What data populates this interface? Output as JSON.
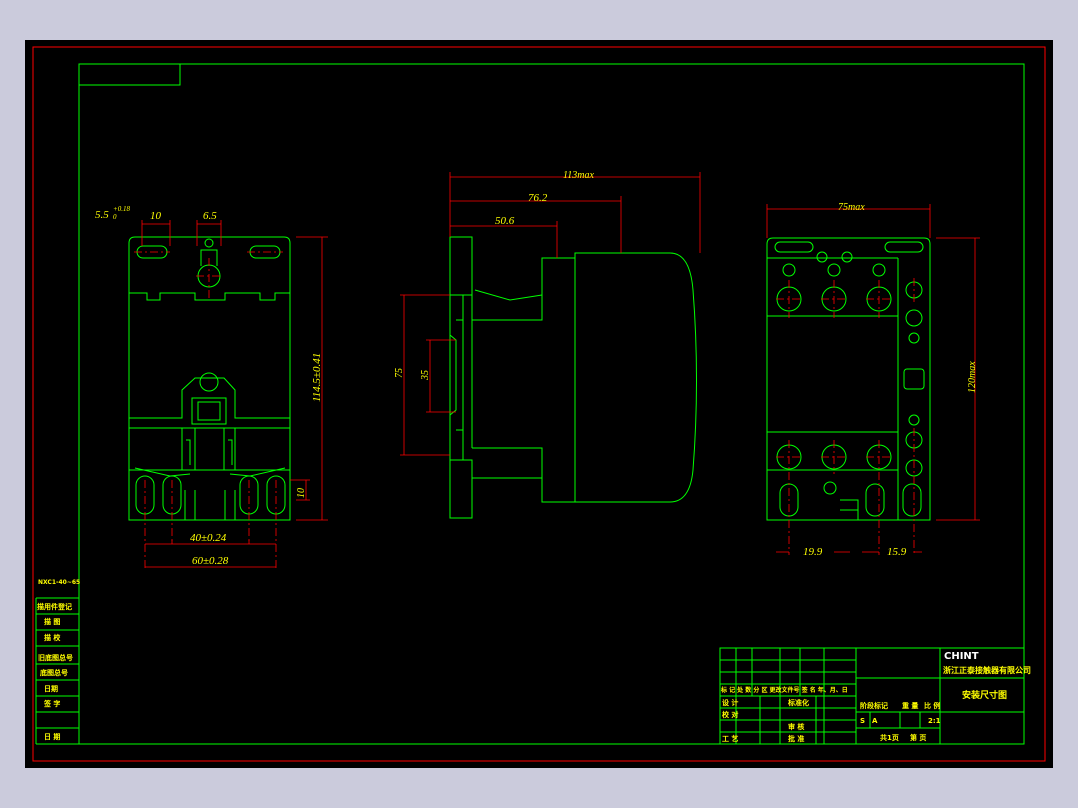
{
  "colors": {
    "background": "#cbcbdc",
    "paper": "#000000",
    "border": "#ff0000",
    "frame": "#00ff00",
    "dimension": "#ff0000",
    "text": "#ffff00",
    "centerline": "#ff0000"
  },
  "front_view": {
    "slot_dia": "5.5",
    "slot_tol_upper": "+0.18",
    "slot_tol_lower": "0",
    "slot_len": "10",
    "hole_dia": "6.5",
    "height": "114.5±0.41",
    "foot": "10",
    "base_inner": "40±0.24",
    "base_outer": "60±0.28"
  },
  "side_view": {
    "overall": "113max",
    "mid": "76.2",
    "near": "50.6",
    "rail_outer": "75",
    "rail_inner": "35"
  },
  "back_view": {
    "width": "75max",
    "height": "120max",
    "pitch_left": "19.9",
    "pitch_right": "15.9"
  },
  "left_column": {
    "model": "NXC1-40~65",
    "rows": [
      "描用件登记",
      "描 图",
      "描 校",
      "旧底图总号",
      "底图总号",
      "日期",
      "签 字",
      "日 期"
    ]
  },
  "title_block": {
    "logo": "CHINT",
    "company": "浙江正泰接触器有限公司",
    "drawing_name": "安装尺寸图",
    "header_row": "标 记 处 数  分 区  更改文件号 签 名  年、月、日",
    "design": "设 计",
    "std": "标准化",
    "check": "校 对",
    "audit": "审 核",
    "process": "工 艺",
    "approve": "批 准",
    "stage_label": "阶段标记",
    "weight_label": "重 量",
    "scale_label": "比 例",
    "stage_s": "S",
    "stage_a": "A",
    "scale": "2:1",
    "sheets": "共1页",
    "sheet_no": "第  页"
  }
}
